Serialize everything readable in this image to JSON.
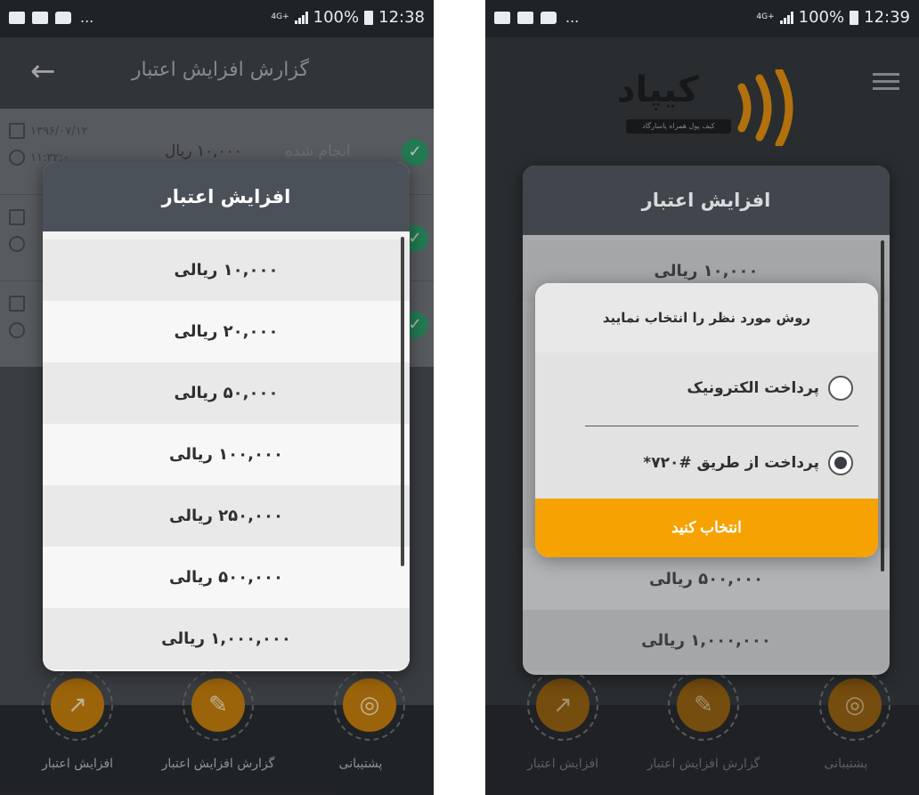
{
  "left": {
    "status": {
      "time": "12:38",
      "battery": "100%",
      "network": "4G+",
      "notif_more": "..."
    },
    "appbar": {
      "title": "گزارش افزایش اعتبار"
    },
    "report_rows": [
      {
        "date": "۱۳۹۶/۰۷/۱۲",
        "time": "۱۱:۳۲:۰",
        "amount": "۱۰,۰۰۰ ریال",
        "status": "انجام شده"
      },
      {
        "date": "",
        "time": "",
        "amount": "",
        "status": ""
      },
      {
        "date": "",
        "time": "",
        "amount": "",
        "status": ""
      }
    ],
    "dialog": {
      "title": "افزایش اعتبار",
      "options": [
        "۱۰,۰۰۰ ریالی",
        "۲۰,۰۰۰ ریالی",
        "۵۰,۰۰۰ ریالی",
        "۱۰۰,۰۰۰ ریالی",
        "۲۵۰,۰۰۰ ریالی",
        "۵۰۰,۰۰۰ ریالی",
        "۱,۰۰۰,۰۰۰ ریالی"
      ]
    },
    "nav": {
      "increase": "افزایش اعتبار",
      "report": "گزارش افزایش اعتبار",
      "support": "پشتیبانی"
    }
  },
  "right": {
    "status": {
      "time": "12:39",
      "battery": "100%",
      "network": "4G+",
      "notif_more": "..."
    },
    "logo": {
      "name": "کیپاد",
      "tagline": "کیف پول همراه پاسارگاد"
    },
    "dialog": {
      "title": "افزایش اعتبار",
      "options_visible_top": "۱۰,۰۰۰ ریالی",
      "options_visible_bottom": [
        "۵۰۰,۰۰۰ ریالی",
        "۱,۰۰۰,۰۰۰ ریالی"
      ]
    },
    "method_dialog": {
      "title": "روش مورد نظر را انتخاب نمایید",
      "option_electronic": "پرداخت الکترونیک",
      "option_ussd": "پرداخت از طریق #۷۲۰*",
      "selected": "ussd",
      "confirm": "انتخاب کنید"
    },
    "nav": {
      "increase": "افزایش اعتبار",
      "report": "گزارش افزایش اعتبار",
      "support": "پشتیبانی"
    }
  },
  "colors": {
    "accent": "#f6a203",
    "header": "#4b5158",
    "success": "#2e9d6a"
  },
  "icons": {
    "back": "arrow-left-icon",
    "calendar": "calendar-icon",
    "clock": "clock-icon",
    "check": "check-circle-icon",
    "chart": "chart-icon",
    "report": "edit-document-icon",
    "support": "lifebuoy-icon",
    "menu": "hamburger-menu-icon"
  }
}
